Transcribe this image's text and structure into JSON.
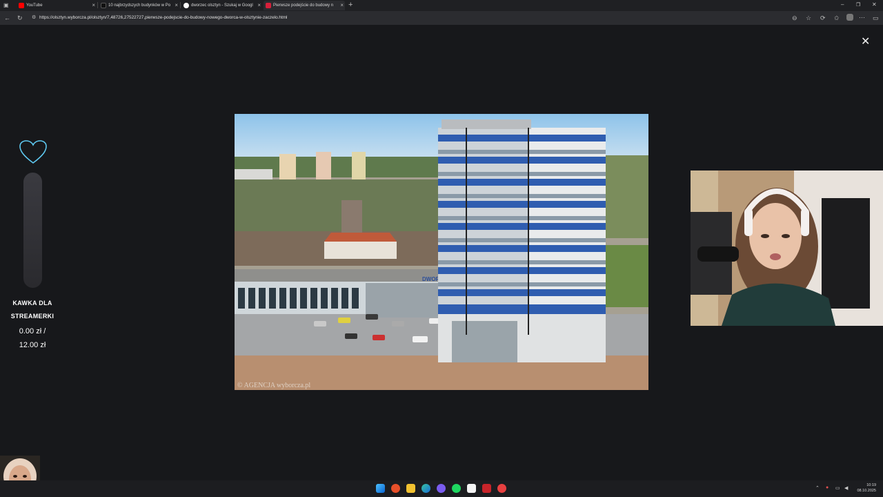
{
  "tabs": [
    {
      "title": "YouTube",
      "color": "#ff0000"
    },
    {
      "title": "10 najbrzydszych budynków w Po",
      "color": "#111111"
    },
    {
      "title": "dworzec olsztyn - Szukaj w Googl",
      "color": "#4285f4"
    },
    {
      "title": "Pierwsze podejście do budowy n",
      "color": "#d6203a"
    }
  ],
  "address_bar": {
    "url": "https://olsztyn.wyborcza.pl/olsztyn/7,48726,27522727,pierwsze-podejscie-do-budowy-nowego-dworca-w-olsztynie-zaczelo.html"
  },
  "photo": {
    "watermark": "© AGENCJA wyborcza.pl",
    "sign": "DWORZEC"
  },
  "donation": {
    "label_line1": "KAWKA DLA",
    "label_line2": "STREAMERKI",
    "current": "0.00 zł /",
    "goal": "12.00 zł",
    "progress": 0
  },
  "taskbar": {
    "time": "10:19",
    "date": "08.10.2025",
    "icons": [
      "start-icon",
      "browser-icon",
      "file-explorer-icon",
      "edge-icon",
      "discord-icon",
      "spotify-icon",
      "notepad-icon",
      "app-icon",
      "chrome-icon"
    ]
  },
  "colors": {
    "accent_heart": "#5ec8f0",
    "background": "#17181b"
  }
}
